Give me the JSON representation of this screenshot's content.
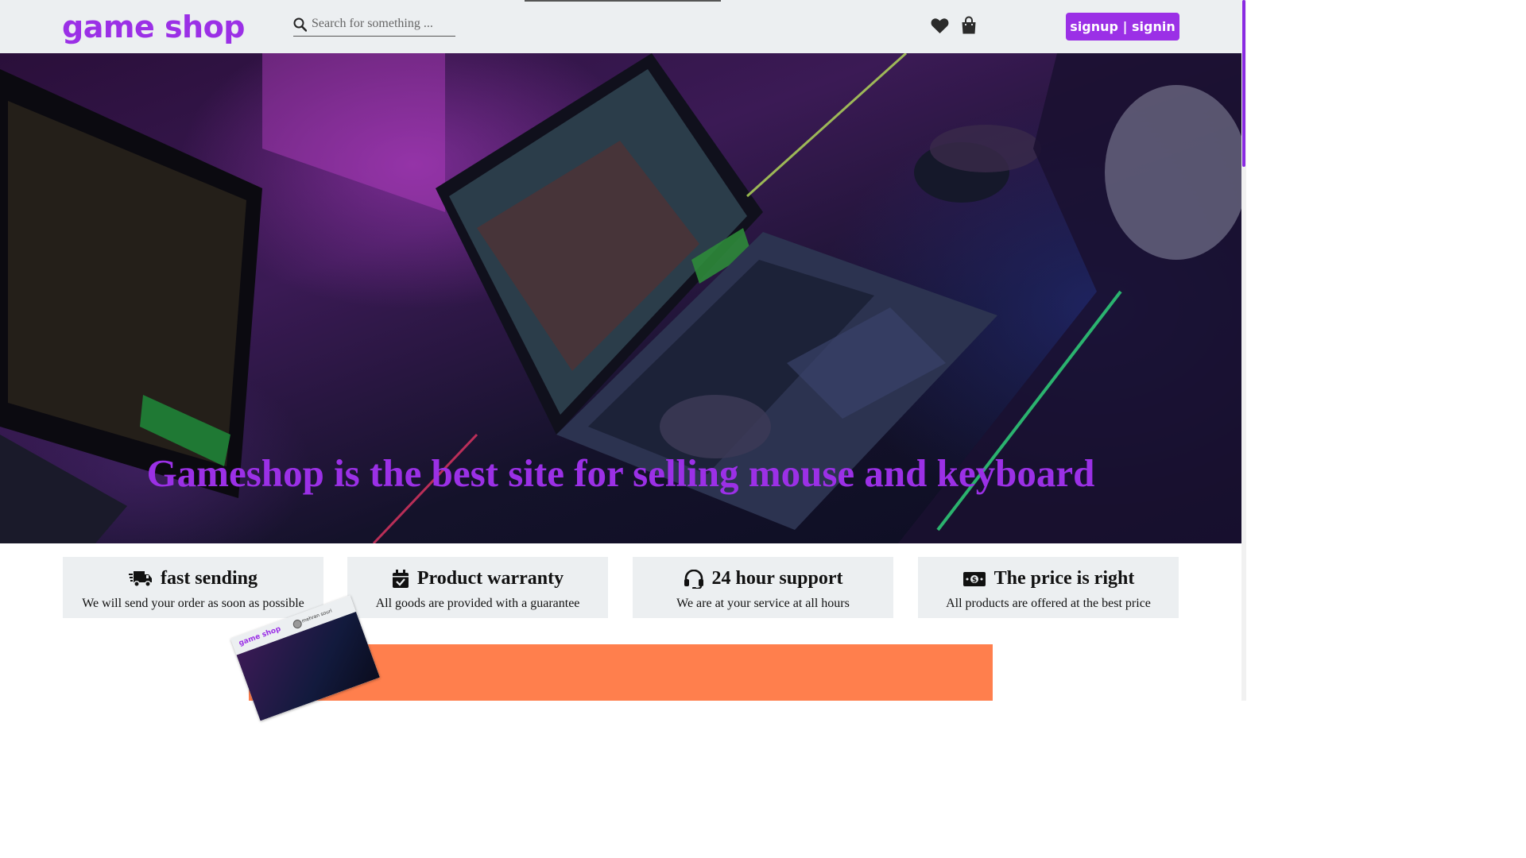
{
  "header": {
    "logo": "game shop",
    "search_placeholder": "Search for something ...",
    "auth_label": "signup | signin"
  },
  "hero": {
    "headline": "Gameshop is the best site for selling mouse and keyboard"
  },
  "features": [
    {
      "icon": "truck-icon",
      "title": "fast sending",
      "description": "We will send your order as soon as possible"
    },
    {
      "icon": "calendar-check-icon",
      "title": "Product warranty",
      "description": "All goods are provided with a guarantee"
    },
    {
      "icon": "headset-icon",
      "title": "24 hour support",
      "description": "We are at your service at all hours"
    },
    {
      "icon": "money-bill-icon",
      "title": "The price is right",
      "description": "All products are offered at the best price"
    }
  ],
  "promo": {
    "thumb_logo": "game shop",
    "thumb_user": "mehran souri"
  },
  "colors": {
    "accent": "#9b30e6",
    "header_bg": "#eceff1",
    "promo_bg": "#ff7f4d"
  }
}
